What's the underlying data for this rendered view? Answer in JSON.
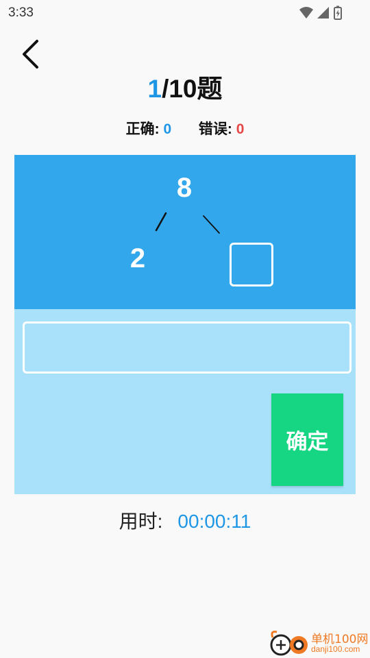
{
  "status_bar": {
    "time": "3:33",
    "icons": [
      "wifi-icon",
      "cell-signal-icon",
      "battery-icon"
    ]
  },
  "nav": {
    "back_icon": "chevron-left-icon"
  },
  "progress": {
    "current": "1",
    "total_text": "/10题"
  },
  "score": {
    "correct_label": "正确:",
    "correct_value": "0",
    "wrong_label": "错误:",
    "wrong_value": "0"
  },
  "question": {
    "top_number": "8",
    "left_number": "2",
    "right_number": ""
  },
  "answer": {
    "input_value": "",
    "confirm_label": "确定"
  },
  "timer": {
    "label": "用时:",
    "value": "00:00:11"
  },
  "watermark": {
    "title": "单机100网",
    "url": "danji100.com"
  },
  "colors": {
    "accent_blue": "#1e96e6",
    "panel_blue": "#32a7ec",
    "panel_light_blue": "#aae1fa",
    "confirm_green": "#17d683",
    "wrong_red": "#e64646"
  }
}
